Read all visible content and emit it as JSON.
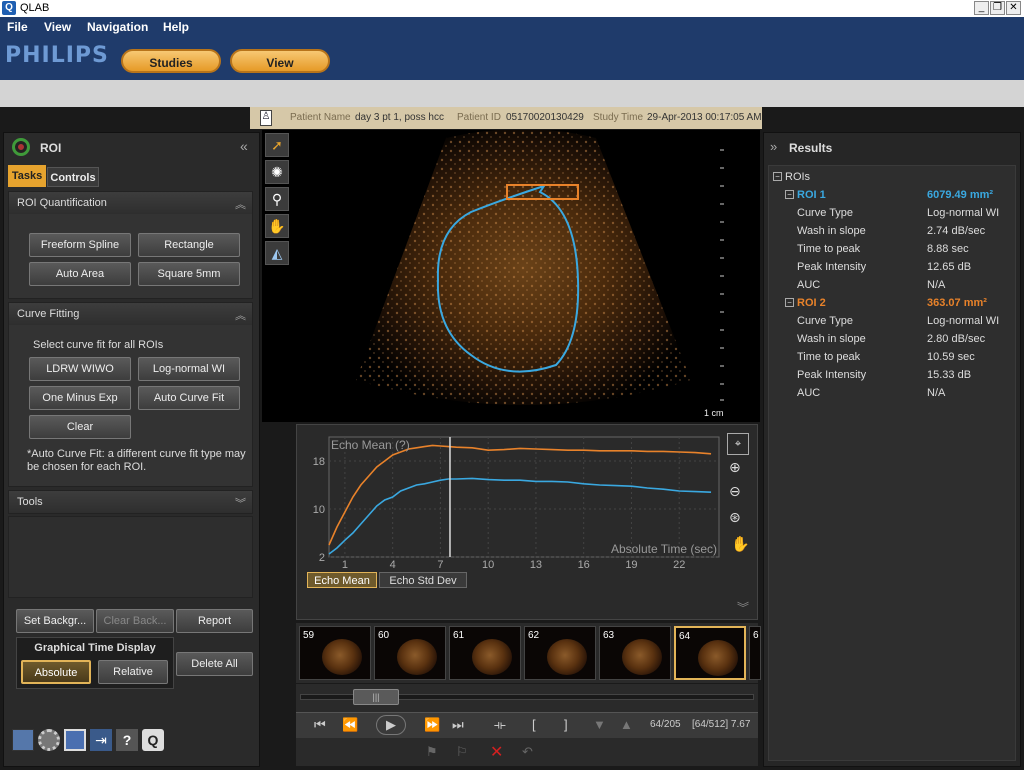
{
  "window": {
    "icon": "Q",
    "title": "QLAB",
    "controls": [
      "_",
      "❐",
      "✕"
    ]
  },
  "menu": [
    "File",
    "View",
    "Navigation",
    "Help"
  ],
  "header": {
    "logo": "PHILIPS",
    "tabs": [
      "Studies",
      "View"
    ]
  },
  "patient": {
    "name_label": "Patient Name",
    "name": "day 3 pt 1, poss hcc",
    "id_label": "Patient ID",
    "id": "05170020130429",
    "time_label": "Study Time",
    "time": "29-Apr-2013 00:17:05 AM"
  },
  "left": {
    "title": "ROI",
    "tabs": [
      "Tasks",
      "Controls"
    ],
    "roi_quant": {
      "title": "ROI Quantification",
      "buttons": [
        "Freeform Spline",
        "Rectangle",
        "Auto Area",
        "Square 5mm"
      ]
    },
    "curve_fitting": {
      "title": "Curve Fitting",
      "prompt": "Select curve fit for all ROIs",
      "buttons": [
        "LDRW WIWO",
        "Log-normal WI",
        "One Minus Exp",
        "Auto Curve Fit",
        "Clear"
      ],
      "note": "*Auto Curve Fit: a different curve fit type may be chosen for each ROI."
    },
    "tools_title": "Tools",
    "bottom": {
      "set_background": "Set Backgr...",
      "clear_background": "Clear Back...",
      "report": "Report",
      "graph_time_title": "Graphical Time Display",
      "absolute": "Absolute",
      "relative": "Relative",
      "delete_all": "Delete All"
    },
    "toolbar_icons": [
      "film-icon",
      "settings-icon",
      "save-icon",
      "exit-icon",
      "help-icon",
      "q-icon"
    ]
  },
  "image": {
    "scale_label": "1 cm"
  },
  "chart_data": {
    "type": "line",
    "title": "Echo Mean (?)",
    "xlabel": "Absolute Time (sec)",
    "ylabel": "",
    "xlim": [
      0,
      24.5
    ],
    "ylim": [
      2,
      22
    ],
    "xticks": [
      1,
      4,
      7,
      10,
      13,
      16,
      19,
      22
    ],
    "yticks": [
      2,
      10,
      18
    ],
    "cursor_x": 7.6,
    "series": [
      {
        "name": "ROI 1",
        "color": "#3aa8e0",
        "x": [
          0,
          0.5,
          1,
          1.5,
          2,
          2.5,
          3,
          3.5,
          4,
          4.5,
          5,
          5.5,
          6,
          6.5,
          7,
          7.5,
          8,
          9,
          10,
          11,
          12,
          13,
          14,
          15,
          16,
          17,
          18,
          19,
          20,
          21,
          22,
          23,
          24
        ],
        "values": [
          2.5,
          3.5,
          4.8,
          6,
          7.5,
          9,
          10.5,
          11.5,
          12,
          13,
          13.5,
          14,
          14.2,
          14.5,
          14.8,
          15,
          15,
          15.1,
          14.9,
          14.8,
          14.8,
          14.6,
          14.6,
          14.5,
          14.2,
          14,
          13.9,
          13.8,
          13.5,
          13.3,
          13.0,
          12.9,
          12.8
        ]
      },
      {
        "name": "ROI 2",
        "color": "#e8822a",
        "x": [
          0,
          0.5,
          1,
          1.5,
          2,
          2.5,
          3,
          3.5,
          4,
          4.5,
          5,
          5.5,
          6,
          6.5,
          7,
          7.5,
          8,
          9,
          10,
          11,
          12,
          13,
          14,
          15,
          16,
          17,
          18,
          19,
          20,
          21,
          22,
          23,
          24
        ],
        "values": [
          4,
          7,
          9.5,
          12,
          14,
          15.5,
          17,
          18,
          19,
          19.5,
          20,
          20.2,
          20.4,
          20.6,
          20.5,
          20.4,
          20.3,
          20.2,
          19.8,
          19.9,
          20.1,
          20.0,
          19.9,
          19.8,
          19.8,
          19.7,
          19.7,
          19.7,
          19.6,
          19.6,
          19.5,
          19.4,
          19.2
        ]
      }
    ],
    "legend_position": "none",
    "buttons": [
      "Echo Mean",
      "Echo Std Dev"
    ]
  },
  "thumbs": [
    "59",
    "60",
    "61",
    "62",
    "63",
    "64",
    "6"
  ],
  "playback": {
    "frame": "64/205",
    "total": "[64/512] 7.67",
    "slider_position": 0.13
  },
  "results": {
    "title": "Results",
    "root": "ROIs",
    "rois": [
      {
        "name": "ROI 1",
        "value": "6079.49 mm²",
        "color": "#3aa8e0",
        "rows": [
          [
            "Curve Type",
            "Log-normal WI"
          ],
          [
            "Wash in slope",
            "2.74 dB/sec"
          ],
          [
            "Time to peak",
            "8.88 sec"
          ],
          [
            "Peak Intensity",
            "12.65 dB"
          ],
          [
            "AUC",
            "N/A"
          ]
        ]
      },
      {
        "name": "ROI 2",
        "value": "363.07 mm²",
        "color": "#e8822a",
        "rows": [
          [
            "Curve Type",
            "Log-normal WI"
          ],
          [
            "Wash in slope",
            "2.80 dB/sec"
          ],
          [
            "Time to peak",
            "10.59 sec"
          ],
          [
            "Peak Intensity",
            "15.33 dB"
          ],
          [
            "AUC",
            "N/A"
          ]
        ]
      }
    ]
  }
}
